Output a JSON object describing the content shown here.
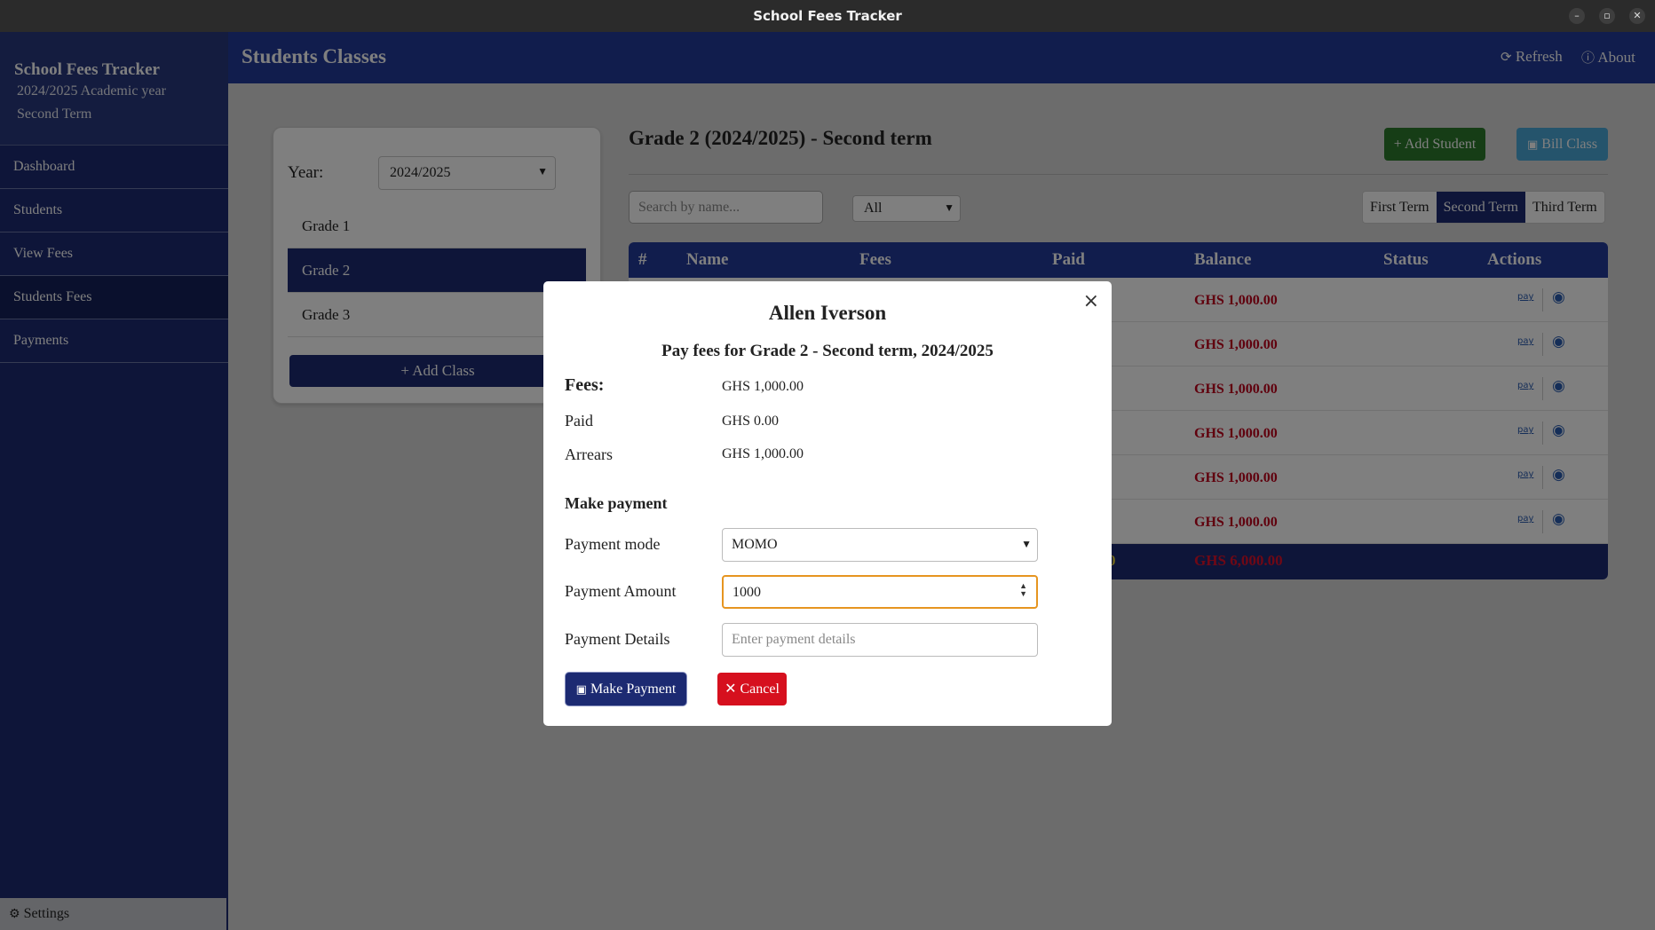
{
  "window": {
    "title": "School Fees Tracker"
  },
  "sidebar": {
    "brand": "School Fees Tracker",
    "year_line": "2024/2025 Academic year",
    "term_line": "Second Term",
    "items": [
      {
        "label": "Dashboard"
      },
      {
        "label": "Students"
      },
      {
        "label": "View Fees"
      },
      {
        "label": "Students Fees"
      },
      {
        "label": "Payments"
      }
    ],
    "settings": "Settings"
  },
  "header": {
    "title": "Students Classes",
    "refresh": "Refresh",
    "about": "About"
  },
  "classes_panel": {
    "year_label": "Year:",
    "year_value": "2024/2025",
    "grades": [
      "Grade 1",
      "Grade 2",
      "Grade 3"
    ],
    "add_class": "Add Class"
  },
  "main": {
    "title": "Grade 2 (2024/2025) - Second term",
    "add_student": "Add Student",
    "bill_class": "Bill Class",
    "search_placeholder": "Search by name...",
    "filter_value": "All",
    "terms": [
      "First Term",
      "Second Term",
      "Third Term"
    ],
    "table": {
      "headers": [
        "#",
        "Name",
        "Fees",
        "Paid",
        "Balance",
        "Status",
        "Actions"
      ],
      "balances": [
        "GHS 1,000.00",
        "GHS 1,000.00",
        "GHS 1,000.00",
        "GHS 1,000.00",
        "GHS 1,000.00",
        "GHS 1,000.00"
      ],
      "footer_paid_fragment": "0",
      "footer_balance": "GHS 6,000.00"
    }
  },
  "modal": {
    "close": "×",
    "student_name": "Allen Iverson",
    "subtitle": "Pay fees for Grade 2 - Second term, 2024/2025",
    "fees_label": "Fees:",
    "fees_value": "GHS 1,000.00",
    "paid_label": "Paid",
    "paid_value": "GHS 0.00",
    "arrears_label": "Arrears",
    "arrears_value": "GHS 1,000.00",
    "section_title": "Make payment",
    "mode_label": "Payment mode",
    "mode_value": "MOMO",
    "amount_label": "Payment Amount",
    "amount_value": "1000",
    "details_label": "Payment Details",
    "details_placeholder": "Enter payment details",
    "pay_button": "Make Payment",
    "cancel_button": "Cancel"
  },
  "colors": {
    "sidebar": "#1c2a72",
    "header": "#223a9a",
    "balance_red": "#c0001a",
    "focus_border": "#e69520"
  }
}
